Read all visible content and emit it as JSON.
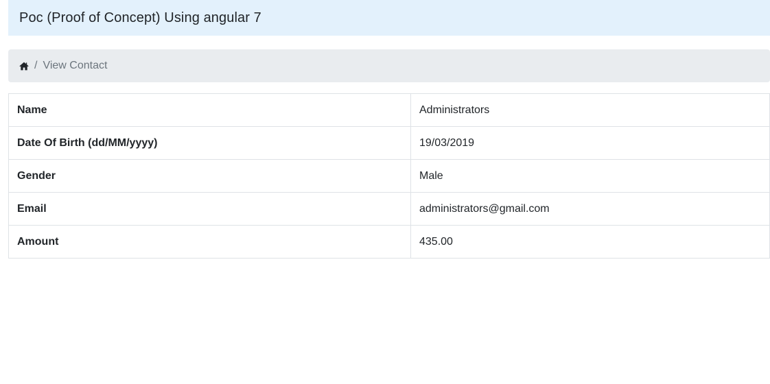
{
  "header": {
    "title": "Poc (Proof of Concept) Using angular 7"
  },
  "breadcrumb": {
    "home_icon": "home-icon",
    "separator": "/",
    "current": "View Contact"
  },
  "details": {
    "rows": [
      {
        "label": "Name",
        "value": "Administrators"
      },
      {
        "label": "Date Of Birth (dd/MM/yyyy)",
        "value": "19/03/2019"
      },
      {
        "label": "Gender",
        "value": "Male"
      },
      {
        "label": "Email",
        "value": "administrators@gmail.com"
      },
      {
        "label": "Amount",
        "value": "435.00"
      }
    ]
  },
  "colors": {
    "header_bg": "#e3f1fc",
    "breadcrumb_bg": "#e9ecef",
    "muted_text": "#6c757d",
    "border": "#dee2e6"
  }
}
